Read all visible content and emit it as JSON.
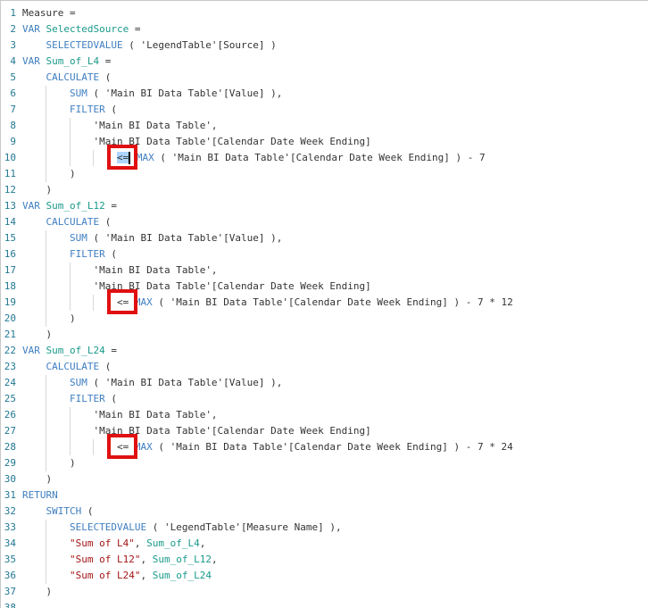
{
  "editor": {
    "colors": {
      "keyword": "#3f7ec0",
      "variable": "#1a9a8a",
      "string": "#a31515",
      "highlight": "#e01010"
    },
    "highlighted_lines": [
      10,
      19,
      28
    ],
    "lines": [
      {
        "n": "1",
        "indent": 0,
        "tokens": [
          {
            "c": "txt",
            "v": "Measure ="
          }
        ]
      },
      {
        "n": "2",
        "indent": 0,
        "tokens": [
          {
            "c": "kw",
            "v": "VAR "
          },
          {
            "c": "var",
            "v": "SelectedSource"
          },
          {
            "c": "txt",
            "v": " ="
          }
        ]
      },
      {
        "n": "3",
        "indent": 1,
        "tokens": [
          {
            "c": "kw",
            "v": "SELECTEDVALUE"
          },
          {
            "c": "txt",
            "v": " ( 'LegendTable'[Source] )"
          }
        ]
      },
      {
        "n": "4",
        "indent": 0,
        "tokens": [
          {
            "c": "kw",
            "v": "VAR "
          },
          {
            "c": "var",
            "v": "Sum_of_L4"
          },
          {
            "c": "txt",
            "v": " ="
          }
        ]
      },
      {
        "n": "5",
        "indent": 1,
        "tokens": [
          {
            "c": "kw",
            "v": "CALCULATE"
          },
          {
            "c": "txt",
            "v": " ("
          }
        ]
      },
      {
        "n": "6",
        "indent": 2,
        "tokens": [
          {
            "c": "kw",
            "v": "SUM"
          },
          {
            "c": "txt",
            "v": " ( 'Main BI Data Table'[Value] ),"
          }
        ]
      },
      {
        "n": "7",
        "indent": 2,
        "tokens": [
          {
            "c": "kw",
            "v": "FILTER"
          },
          {
            "c": "txt",
            "v": " ("
          }
        ]
      },
      {
        "n": "8",
        "indent": 3,
        "tokens": [
          {
            "c": "txt",
            "v": "'Main BI Data Table',"
          }
        ]
      },
      {
        "n": "9",
        "indent": 3,
        "tokens": [
          {
            "c": "txt",
            "v": "'Main BI Data Table'[Calendar Date Week Ending]"
          }
        ]
      },
      {
        "n": "10",
        "indent": 4,
        "tokens": [
          {
            "c": "txt sel",
            "v": "<="
          },
          {
            "c": "caret",
            "v": ""
          },
          {
            "c": "txt",
            "v": " "
          },
          {
            "c": "kw",
            "v": "MAX"
          },
          {
            "c": "txt",
            "v": " ( 'Main BI Data Table'[Calendar Date Week Ending] ) - 7"
          }
        ]
      },
      {
        "n": "11",
        "indent": 2,
        "tokens": [
          {
            "c": "txt",
            "v": ")"
          }
        ]
      },
      {
        "n": "12",
        "indent": 1,
        "tokens": [
          {
            "c": "txt",
            "v": ")"
          }
        ]
      },
      {
        "n": "13",
        "indent": 0,
        "tokens": [
          {
            "c": "kw",
            "v": "VAR "
          },
          {
            "c": "var",
            "v": "Sum_of_L12"
          },
          {
            "c": "txt",
            "v": " ="
          }
        ]
      },
      {
        "n": "14",
        "indent": 1,
        "tokens": [
          {
            "c": "kw",
            "v": "CALCULATE"
          },
          {
            "c": "txt",
            "v": " ("
          }
        ]
      },
      {
        "n": "15",
        "indent": 2,
        "tokens": [
          {
            "c": "kw",
            "v": "SUM"
          },
          {
            "c": "txt",
            "v": " ( 'Main BI Data Table'[Value] ),"
          }
        ]
      },
      {
        "n": "16",
        "indent": 2,
        "tokens": [
          {
            "c": "kw",
            "v": "FILTER"
          },
          {
            "c": "txt",
            "v": " ("
          }
        ]
      },
      {
        "n": "17",
        "indent": 3,
        "tokens": [
          {
            "c": "txt",
            "v": "'Main BI Data Table',"
          }
        ]
      },
      {
        "n": "18",
        "indent": 3,
        "tokens": [
          {
            "c": "txt",
            "v": "'Main BI Data Table'[Calendar Date Week Ending]"
          }
        ]
      },
      {
        "n": "19",
        "indent": 4,
        "tokens": [
          {
            "c": "txt",
            "v": "<= "
          },
          {
            "c": "kw",
            "v": "MAX"
          },
          {
            "c": "txt",
            "v": " ( 'Main BI Data Table'[Calendar Date Week Ending] ) - 7 * 12"
          }
        ]
      },
      {
        "n": "20",
        "indent": 2,
        "tokens": [
          {
            "c": "txt",
            "v": ")"
          }
        ]
      },
      {
        "n": "21",
        "indent": 1,
        "tokens": [
          {
            "c": "txt",
            "v": ")"
          }
        ]
      },
      {
        "n": "22",
        "indent": 0,
        "tokens": [
          {
            "c": "kw",
            "v": "VAR "
          },
          {
            "c": "var",
            "v": "Sum_of_L24"
          },
          {
            "c": "txt",
            "v": " ="
          }
        ]
      },
      {
        "n": "23",
        "indent": 1,
        "tokens": [
          {
            "c": "kw",
            "v": "CALCULATE"
          },
          {
            "c": "txt",
            "v": " ("
          }
        ]
      },
      {
        "n": "24",
        "indent": 2,
        "tokens": [
          {
            "c": "kw",
            "v": "SUM"
          },
          {
            "c": "txt",
            "v": " ( 'Main BI Data Table'[Value] ),"
          }
        ]
      },
      {
        "n": "25",
        "indent": 2,
        "tokens": [
          {
            "c": "kw",
            "v": "FILTER"
          },
          {
            "c": "txt",
            "v": " ("
          }
        ]
      },
      {
        "n": "26",
        "indent": 3,
        "tokens": [
          {
            "c": "txt",
            "v": "'Main BI Data Table',"
          }
        ]
      },
      {
        "n": "27",
        "indent": 3,
        "tokens": [
          {
            "c": "txt",
            "v": "'Main BI Data Table'[Calendar Date Week Ending]"
          }
        ]
      },
      {
        "n": "28",
        "indent": 4,
        "tokens": [
          {
            "c": "txt",
            "v": "<= "
          },
          {
            "c": "kw",
            "v": "MAX"
          },
          {
            "c": "txt",
            "v": " ( 'Main BI Data Table'[Calendar Date Week Ending] ) - 7 * 24"
          }
        ]
      },
      {
        "n": "29",
        "indent": 2,
        "tokens": [
          {
            "c": "txt",
            "v": ")"
          }
        ]
      },
      {
        "n": "30",
        "indent": 1,
        "tokens": [
          {
            "c": "txt",
            "v": ")"
          }
        ]
      },
      {
        "n": "31",
        "indent": 0,
        "tokens": [
          {
            "c": "kw",
            "v": "RETURN"
          }
        ]
      },
      {
        "n": "32",
        "indent": 1,
        "tokens": [
          {
            "c": "kw",
            "v": "SWITCH"
          },
          {
            "c": "txt",
            "v": " ("
          }
        ]
      },
      {
        "n": "33",
        "indent": 2,
        "tokens": [
          {
            "c": "kw",
            "v": "SELECTEDVALUE"
          },
          {
            "c": "txt",
            "v": " ( 'LegendTable'[Measure Name] ),"
          }
        ]
      },
      {
        "n": "34",
        "indent": 2,
        "tokens": [
          {
            "c": "str",
            "v": "\"Sum of L4\""
          },
          {
            "c": "txt",
            "v": ", "
          },
          {
            "c": "var",
            "v": "Sum_of_L4"
          },
          {
            "c": "txt",
            "v": ","
          }
        ]
      },
      {
        "n": "35",
        "indent": 2,
        "tokens": [
          {
            "c": "str",
            "v": "\"Sum of L12\""
          },
          {
            "c": "txt",
            "v": ", "
          },
          {
            "c": "var",
            "v": "Sum_of_L12"
          },
          {
            "c": "txt",
            "v": ","
          }
        ]
      },
      {
        "n": "36",
        "indent": 2,
        "tokens": [
          {
            "c": "str",
            "v": "\"Sum of L24\""
          },
          {
            "c": "txt",
            "v": ", "
          },
          {
            "c": "var",
            "v": "Sum_of_L24"
          }
        ]
      },
      {
        "n": "37",
        "indent": 1,
        "tokens": [
          {
            "c": "txt",
            "v": ")"
          }
        ]
      },
      {
        "n": "38",
        "indent": 0,
        "tokens": []
      }
    ]
  }
}
